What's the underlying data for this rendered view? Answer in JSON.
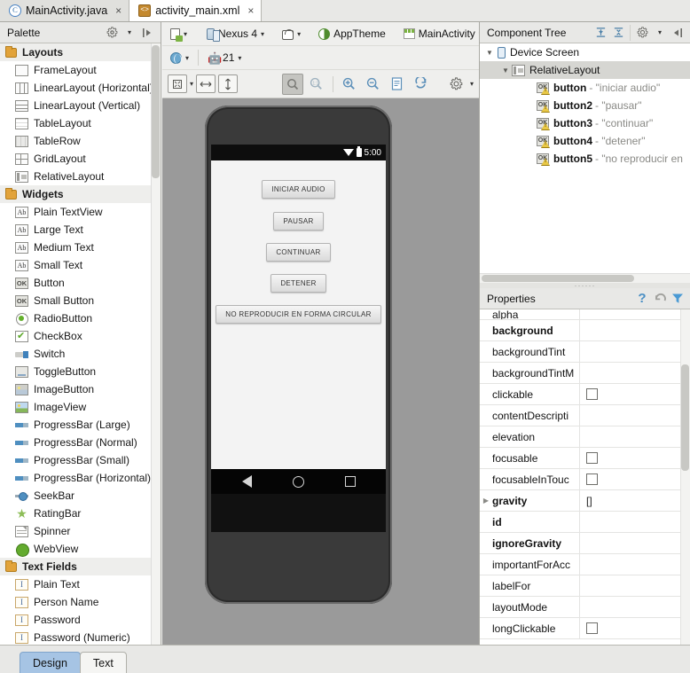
{
  "window": {
    "tabs": [
      {
        "label": "MainActivity.java",
        "icon": "java-class-icon",
        "glyph": "C",
        "active": false,
        "close": "×"
      },
      {
        "label": "activity_main.xml",
        "icon": "xml-file-icon",
        "glyph": "<>",
        "active": true,
        "close": "×"
      }
    ]
  },
  "palette": {
    "title": "Palette",
    "gear_icon": "gear-icon",
    "collapse_icon": "collapse-panel-icon",
    "groups": [
      {
        "label": "Layouts",
        "items": [
          {
            "label": "FrameLayout",
            "icon": "frame-layout-icon"
          },
          {
            "label": "LinearLayout (Horizontal)",
            "icon": "linear-layout-horizontal-icon"
          },
          {
            "label": "LinearLayout (Vertical)",
            "icon": "linear-layout-vertical-icon"
          },
          {
            "label": "TableLayout",
            "icon": "table-layout-icon"
          },
          {
            "label": "TableRow",
            "icon": "table-row-icon"
          },
          {
            "label": "GridLayout",
            "icon": "grid-layout-icon"
          },
          {
            "label": "RelativeLayout",
            "icon": "relative-layout-icon"
          }
        ]
      },
      {
        "label": "Widgets",
        "items": [
          {
            "label": "Plain TextView",
            "icon": "text-view-icon",
            "glyph": "Ab"
          },
          {
            "label": "Large Text",
            "icon": "text-view-icon",
            "glyph": "Ab"
          },
          {
            "label": "Medium Text",
            "icon": "text-view-icon",
            "glyph": "Ab"
          },
          {
            "label": "Small Text",
            "icon": "text-view-icon",
            "glyph": "Ab"
          },
          {
            "label": "Button",
            "icon": "button-icon",
            "glyph": "OK"
          },
          {
            "label": "Small Button",
            "icon": "button-icon",
            "glyph": "OK"
          },
          {
            "label": "RadioButton",
            "icon": "radio-button-icon"
          },
          {
            "label": "CheckBox",
            "icon": "checkbox-icon"
          },
          {
            "label": "Switch",
            "icon": "switch-icon"
          },
          {
            "label": "ToggleButton",
            "icon": "toggle-button-icon"
          },
          {
            "label": "ImageButton",
            "icon": "image-button-icon"
          },
          {
            "label": "ImageView",
            "icon": "image-view-icon"
          },
          {
            "label": "ProgressBar (Large)",
            "icon": "progress-bar-icon"
          },
          {
            "label": "ProgressBar (Normal)",
            "icon": "progress-bar-icon"
          },
          {
            "label": "ProgressBar (Small)",
            "icon": "progress-bar-icon"
          },
          {
            "label": "ProgressBar (Horizontal)",
            "icon": "progress-bar-icon"
          },
          {
            "label": "SeekBar",
            "icon": "seek-bar-icon"
          },
          {
            "label": "RatingBar",
            "icon": "rating-bar-icon",
            "glyph": "★"
          },
          {
            "label": "Spinner",
            "icon": "spinner-icon"
          },
          {
            "label": "WebView",
            "icon": "web-view-icon"
          }
        ]
      },
      {
        "label": "Text Fields",
        "items": [
          {
            "label": "Plain Text",
            "icon": "text-field-icon",
            "glyph": "I"
          },
          {
            "label": "Person Name",
            "icon": "text-field-icon",
            "glyph": "I"
          },
          {
            "label": "Password",
            "icon": "text-field-icon",
            "glyph": "I"
          },
          {
            "label": "Password (Numeric)",
            "icon": "text-field-icon",
            "glyph": "I"
          }
        ]
      }
    ]
  },
  "design_toolbar": {
    "row1": {
      "device_config_icon": "device-config-icon",
      "device": "Nexus 4",
      "orientation_icon": "orientation-icon",
      "theme": "AppTheme",
      "theme_icon": "theme-icon",
      "activity": "MainActivity",
      "activity_icon": "activity-icon",
      "caret": "▾"
    },
    "row2": {
      "locale_icon": "locale-globe-icon",
      "api_level": "21",
      "api_icon": "android-api-icon",
      "caret": "▾"
    },
    "row3": {
      "zoom_fit_icon": "zoom-to-fit-icon",
      "zoom_width_icon": "fit-width-icon",
      "zoom_height_icon": "fit-height-icon",
      "select_mode_icon": "select-tool-icon",
      "zoom_actual_icon": "zoom-actual-size-icon",
      "zoom_in_icon": "zoom-in-icon",
      "zoom_out_icon": "zoom-out-icon",
      "screenshot_icon": "screenshot-icon",
      "refresh_icon": "refresh-render-icon",
      "settings_icon": "render-settings-icon",
      "caret": "▾"
    }
  },
  "preview": {
    "status_bar": {
      "clock": "5:00",
      "wifi_icon": "wifi-icon",
      "battery_icon": "battery-icon"
    },
    "buttons": [
      "INICIAR AUDIO",
      "PAUSAR",
      "CONTINUAR",
      "DETENER",
      "NO REPRODUCIR EN FORMA CIRCULAR"
    ],
    "nav_bar": {
      "back_icon": "nav-back-icon",
      "home_icon": "nav-home-icon",
      "recents_icon": "nav-recents-icon"
    }
  },
  "component_tree": {
    "title": "Component Tree",
    "expand_all_icon": "expand-all-icon",
    "collapse_all_icon": "collapse-all-icon",
    "gear_icon": "gear-icon",
    "collapse_panel_icon": "collapse-panel-icon",
    "caret": "▾",
    "nodes": [
      {
        "name": "Device Screen",
        "value": "",
        "icon": "device-screen-icon",
        "twisty": "▼",
        "indent": 0,
        "selected": false
      },
      {
        "name": "RelativeLayout",
        "value": "",
        "icon": "relative-layout-icon",
        "twisty": "▼",
        "indent": 1,
        "selected": true
      },
      {
        "name": "button",
        "value": "- \"iniciar audio\"",
        "icon": "button-warning-icon",
        "twisty": "",
        "indent": 2,
        "selected": false
      },
      {
        "name": "button2",
        "value": "- \"pausar\"",
        "icon": "button-warning-icon",
        "twisty": "",
        "indent": 2,
        "selected": false
      },
      {
        "name": "button3",
        "value": "- \"continuar\"",
        "icon": "button-warning-icon",
        "twisty": "",
        "indent": 2,
        "selected": false
      },
      {
        "name": "button4",
        "value": "- \"detener\"",
        "icon": "button-warning-icon",
        "twisty": "",
        "indent": 2,
        "selected": false
      },
      {
        "name": "button5",
        "value": "- \"no reproducir en",
        "icon": "button-warning-icon",
        "twisty": "",
        "indent": 2,
        "selected": false
      }
    ]
  },
  "properties": {
    "title": "Properties",
    "help_icon": "help-icon",
    "restore_icon": "restore-default-icon",
    "filter_icon": "filter-icon",
    "rows": [
      {
        "name": "alpha",
        "value": "",
        "bold": false,
        "expandable": false,
        "checkbox": false,
        "clipped": true
      },
      {
        "name": "background",
        "value": "",
        "bold": true,
        "expandable": false,
        "checkbox": false
      },
      {
        "name": "backgroundTint",
        "value": "",
        "bold": false,
        "expandable": false,
        "checkbox": false
      },
      {
        "name": "backgroundTintM",
        "value": "",
        "bold": false,
        "expandable": false,
        "checkbox": false
      },
      {
        "name": "clickable",
        "value": "",
        "bold": false,
        "expandable": false,
        "checkbox": true
      },
      {
        "name": "contentDescripti",
        "value": "",
        "bold": false,
        "expandable": false,
        "checkbox": false
      },
      {
        "name": "elevation",
        "value": "",
        "bold": false,
        "expandable": false,
        "checkbox": false
      },
      {
        "name": "focusable",
        "value": "",
        "bold": false,
        "expandable": false,
        "checkbox": true
      },
      {
        "name": "focusableInTouc",
        "value": "",
        "bold": false,
        "expandable": false,
        "checkbox": true
      },
      {
        "name": "gravity",
        "value": "[]",
        "bold": true,
        "expandable": true,
        "checkbox": false
      },
      {
        "name": "id",
        "value": "",
        "bold": true,
        "expandable": false,
        "checkbox": false
      },
      {
        "name": "ignoreGravity",
        "value": "",
        "bold": true,
        "expandable": false,
        "checkbox": false
      },
      {
        "name": "importantForAcc",
        "value": "",
        "bold": false,
        "expandable": false,
        "checkbox": false
      },
      {
        "name": "labelFor",
        "value": "",
        "bold": false,
        "expandable": false,
        "checkbox": false
      },
      {
        "name": "layoutMode",
        "value": "",
        "bold": false,
        "expandable": false,
        "checkbox": false
      },
      {
        "name": "longClickable",
        "value": "",
        "bold": false,
        "expandable": false,
        "checkbox": true
      }
    ]
  },
  "bottom_tabs": [
    {
      "label": "Design",
      "active": true
    },
    {
      "label": "Text",
      "active": false
    }
  ],
  "colors": {
    "accent_blue": "#5b8fb9",
    "selection_blue": "#a6c4e4",
    "canvas_gray": "#9a9a9a",
    "panel_gray": "#e8e8e6",
    "warning_yellow": "#e9c846"
  }
}
